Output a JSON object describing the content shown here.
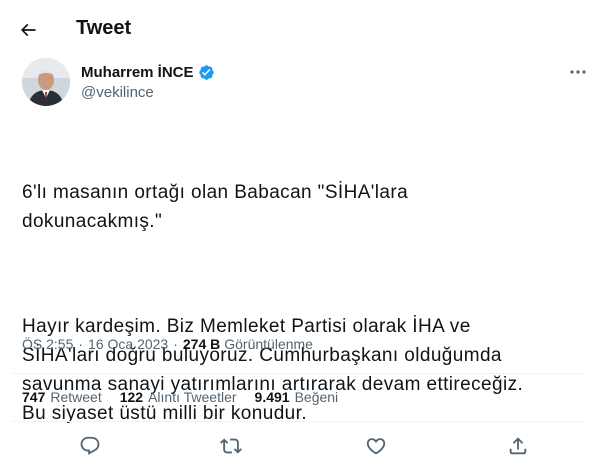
{
  "header": {
    "title": "Tweet",
    "back_icon": "arrow-left-icon"
  },
  "author": {
    "name": "Muharrem İNCE",
    "handle": "@vekilince",
    "verified_color": "#1d9bf0"
  },
  "tweet": {
    "paragraphs": [
      "6'lı masanın ortağı olan Babacan \"SİHA'lara\ndokunacakmış.\"",
      "Hayır kardeşim. Biz Memleket Partisi olarak İHA ve\nSİHA'ları doğru buluyoruz. Cumhurbaşkanı olduğumda\nsavunma sanayi yatırımlarını artırarak devam ettireceğiz.\nBu siyaset üstü milli bir konudur."
    ]
  },
  "meta": {
    "time": "ÖS 2:55",
    "separator": "·",
    "date": "16 Oca 2023",
    "views_count": "274 B",
    "views_label": "Görüntülenme"
  },
  "stats": [
    {
      "count": "747",
      "label": "Retweet"
    },
    {
      "count": "122",
      "label": "Alıntı Tweetler"
    },
    {
      "count": "9.491",
      "label": "Beğeni"
    }
  ],
  "actions": [
    "reply-icon",
    "retweet-icon",
    "like-icon",
    "share-icon"
  ]
}
